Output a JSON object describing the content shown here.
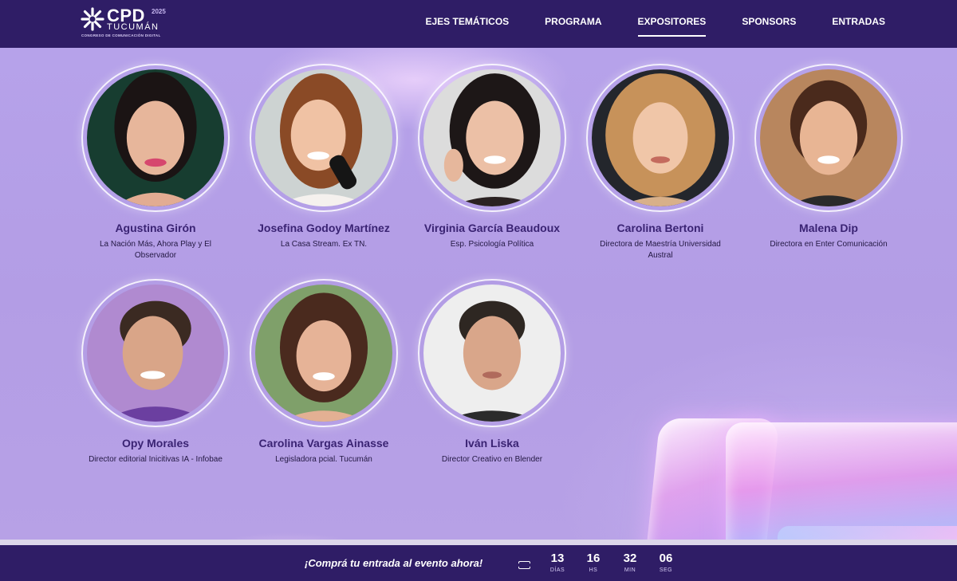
{
  "brand": {
    "name": "CPD",
    "year_digits": "2025",
    "city": "TUCUMÁN",
    "tagline": "CONGRESO DE COMUNICACIÓN DIGITAL",
    "logo_icon": "snowflake-cross-icon"
  },
  "nav": {
    "items": [
      {
        "label": "EJES TEMÁTICOS",
        "active": false
      },
      {
        "label": "PROGRAMA",
        "active": false
      },
      {
        "label": "EXPOSITORES",
        "active": true
      },
      {
        "label": "SPONSORS",
        "active": false
      },
      {
        "label": "ENTRADAS",
        "active": false
      }
    ]
  },
  "speakers": [
    {
      "name": "Agustina Girón",
      "role": "La Nación Más, Ahora Play y El Observador"
    },
    {
      "name": "Josefina Godoy Martínez",
      "role": "La Casa Stream. Ex TN."
    },
    {
      "name": "Virginia García Beaudoux",
      "role": "Esp. Psicología Política"
    },
    {
      "name": "Carolina Bertoni",
      "role": "Directora de Maestría Universidad Austral"
    },
    {
      "name": "Malena Dip",
      "role": "Directora en Enter Comunicación"
    },
    {
      "name": "Opy Morales",
      "role": "Director editorial Inicitivas IA - Infobae"
    },
    {
      "name": "Carolina Vargas Ainasse",
      "role": "Legisladora pcial. Tucumán"
    },
    {
      "name": "Iván Liska",
      "role": "Director Creativo en Blender"
    }
  ],
  "cta": {
    "text": "¡Comprá tu entrada al evento ahora!",
    "icon": "ticket-icon"
  },
  "countdown": [
    {
      "value": "13",
      "label": "DÍAS"
    },
    {
      "value": "16",
      "label": "HS"
    },
    {
      "value": "32",
      "label": "MIN"
    },
    {
      "value": "06",
      "label": "SEG"
    }
  ],
  "colors": {
    "header_bg": "#2f1d66",
    "background": "#b49ee6",
    "name_text": "#3a2373"
  }
}
